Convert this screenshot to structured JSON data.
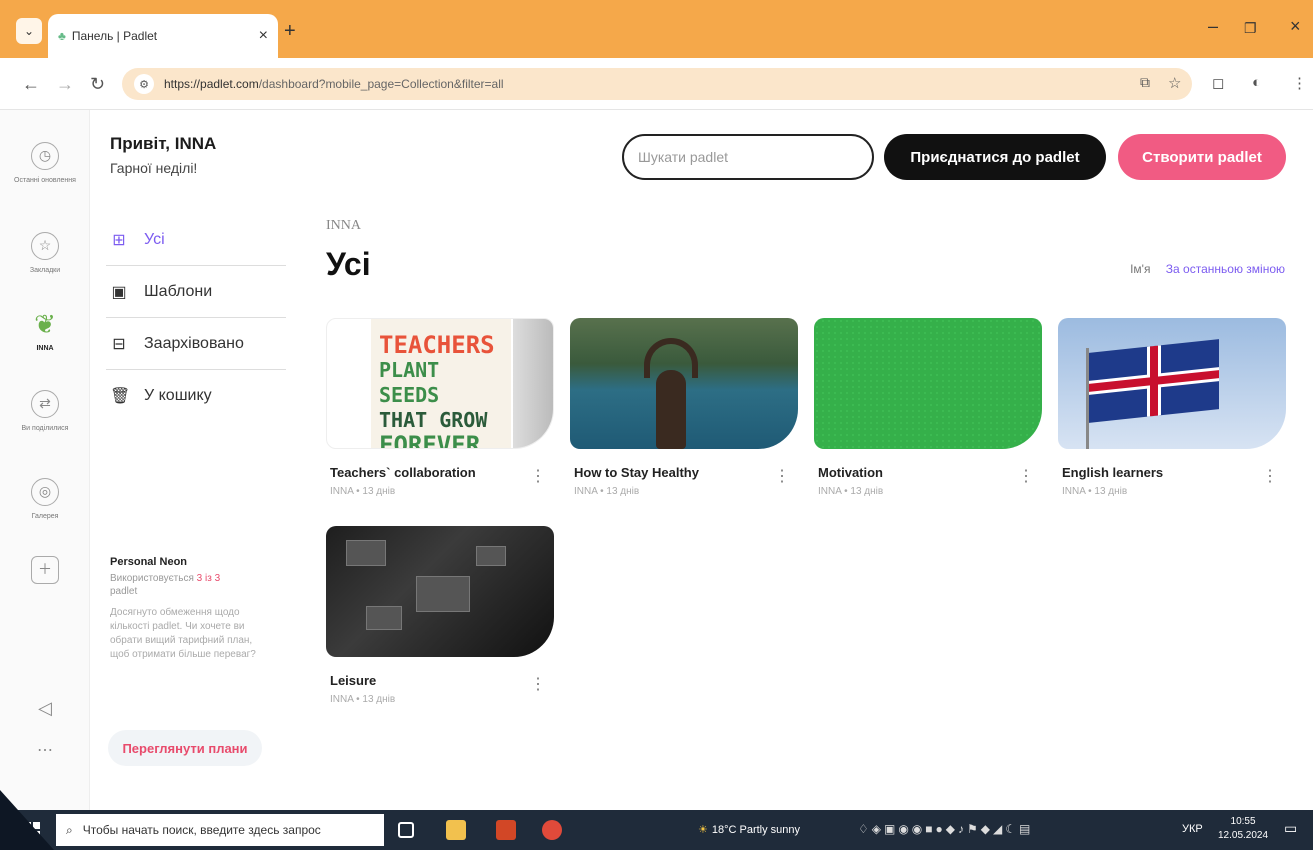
{
  "browser": {
    "tab_title": "Панель | Padlet",
    "url_host": "https://padlet.com",
    "url_path": "/dashboard?mobile_page=Collection&filter=all",
    "accent": "#f5a84a"
  },
  "rail": {
    "items": [
      {
        "label": "Останні оновлення",
        "icon": "clock-icon"
      },
      {
        "label": "Закладки",
        "icon": "star-icon"
      },
      {
        "label": "INNA",
        "icon": "leaf-logo-icon"
      },
      {
        "label": "Ви поділилися",
        "icon": "share-icon"
      },
      {
        "label": "Галерея",
        "icon": "gallery-icon"
      }
    ]
  },
  "greeting": {
    "hello": "Привіт, INNA",
    "sub": "Гарної неділі!"
  },
  "side_nav": [
    {
      "label": "Усі",
      "icon": "grid-icon",
      "active": true
    },
    {
      "label": "Шаблони",
      "icon": "template-icon"
    },
    {
      "label": "Заархівовано",
      "icon": "archive-icon"
    },
    {
      "label": "У кошику",
      "icon": "trash-icon"
    }
  ],
  "plan": {
    "name": "Personal Neon",
    "usage_prefix": "Використовується ",
    "usage_count": "3 із 3",
    "usage_suffix": "padlet",
    "description": "Досягнуто обмеження щодо кількості padlet. Чи хочете ви обрати вищий тарифний план, щоб отримати більше переваг?",
    "button": "Переглянути плани"
  },
  "actions": {
    "search_placeholder": "Шукати padlet",
    "join": "Приєднатися до padlet",
    "create": "Створити padlet"
  },
  "content": {
    "crumb": "INNA",
    "title": "Усі",
    "sort_name": "Ім'я",
    "sort_recent": "За останньою зміною"
  },
  "cards": [
    {
      "title": "Teachers` collaboration",
      "meta": "INNA • 13 днів",
      "thumb_text": [
        "TEACHERS",
        "PLANT SEEDS",
        "THAT GROW",
        "FOREVER"
      ]
    },
    {
      "title": "How to Stay Healthy",
      "meta": "INNA • 13 днів"
    },
    {
      "title": "Motivation",
      "meta": "INNA • 13 днів"
    },
    {
      "title": "English learners",
      "meta": "INNA • 13 днів"
    },
    {
      "title": "Leisure",
      "meta": "INNA • 13 днів"
    }
  ],
  "taskbar": {
    "search": "Чтобы начать поиск, введите здесь запрос",
    "weather": "18°C Partly sunny",
    "lang": "УКР",
    "time": "10:55",
    "date": "12.05.2024"
  }
}
